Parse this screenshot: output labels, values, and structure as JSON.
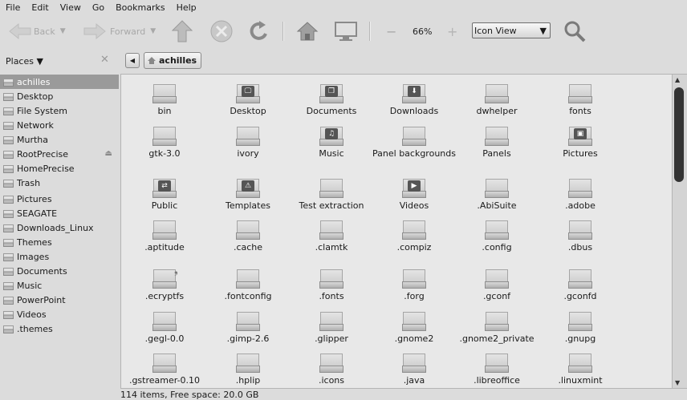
{
  "menu": [
    "File",
    "Edit",
    "View",
    "Go",
    "Bookmarks",
    "Help"
  ],
  "toolbar": {
    "back_label": "Back",
    "forward_label": "Forward",
    "zoom_level": "66%",
    "view_mode": "Icon View"
  },
  "places": {
    "label": "Places ▼"
  },
  "path": {
    "current": "achilles"
  },
  "sidebar": {
    "items": [
      {
        "label": "achilles",
        "icon": "home-icon"
      },
      {
        "label": "Desktop",
        "icon": "folder-icon"
      },
      {
        "label": "File System",
        "icon": "harddisk-icon"
      },
      {
        "label": "Network",
        "icon": "network-icon"
      },
      {
        "label": "Murtha",
        "icon": "folder-icon"
      },
      {
        "label": "RootPrecise",
        "icon": "drive-icon"
      },
      {
        "label": "HomePrecise",
        "icon": "drive-icon"
      },
      {
        "label": "Trash",
        "icon": "trash-icon"
      },
      {
        "label": "Pictures",
        "icon": "folder-icon"
      },
      {
        "label": "SEAGATE",
        "icon": "folder-icon"
      },
      {
        "label": "Downloads_Linux",
        "icon": "folder-icon"
      },
      {
        "label": "Themes",
        "icon": "folder-icon"
      },
      {
        "label": "Images",
        "icon": "folder-icon"
      },
      {
        "label": "Documents",
        "icon": "folder-icon"
      },
      {
        "label": "Music",
        "icon": "folder-icon"
      },
      {
        "label": "PowerPoint",
        "icon": "folder-icon"
      },
      {
        "label": "Videos",
        "icon": "folder-icon"
      },
      {
        "label": ".themes",
        "icon": "folder-icon"
      }
    ]
  },
  "files": [
    {
      "name": "bin",
      "icon": "folder-icon"
    },
    {
      "name": "Desktop",
      "icon": "desktop-icon"
    },
    {
      "name": "Documents",
      "icon": "documents-folder-icon"
    },
    {
      "name": "Downloads",
      "icon": "downloads-folder-icon"
    },
    {
      "name": "dwhelper",
      "icon": "folder-icon"
    },
    {
      "name": "fonts",
      "icon": "folder-icon"
    },
    {
      "name": "gtk-3.0",
      "icon": "folder-icon"
    },
    {
      "name": "ivory",
      "icon": "folder-icon"
    },
    {
      "name": "Music",
      "icon": "music-folder-icon"
    },
    {
      "name": "Panel backgrounds",
      "icon": "folder-icon"
    },
    {
      "name": "Panels",
      "icon": "folder-icon"
    },
    {
      "name": "Pictures",
      "icon": "pictures-folder-icon"
    },
    {
      "name": "Public",
      "icon": "public-folder-icon"
    },
    {
      "name": "Templates",
      "icon": "templates-folder-icon"
    },
    {
      "name": "Test extraction",
      "icon": "folder-icon"
    },
    {
      "name": "Videos",
      "icon": "videos-folder-icon"
    },
    {
      "name": ".AbiSuite",
      "icon": "folder-icon"
    },
    {
      "name": ".adobe",
      "icon": "folder-icon"
    },
    {
      "name": ".aptitude",
      "icon": "folder-icon"
    },
    {
      "name": ".cache",
      "icon": "folder-icon"
    },
    {
      "name": ".clamtk",
      "icon": "folder-icon"
    },
    {
      "name": ".compiz",
      "icon": "folder-icon"
    },
    {
      "name": ".config",
      "icon": "folder-icon"
    },
    {
      "name": ".dbus",
      "icon": "folder-icon"
    },
    {
      "name": ".ecryptfs",
      "icon": "link-folder-icon"
    },
    {
      "name": ".fontconfig",
      "icon": "folder-icon"
    },
    {
      "name": ".fonts",
      "icon": "folder-icon"
    },
    {
      "name": ".forg",
      "icon": "folder-icon"
    },
    {
      "name": ".gconf",
      "icon": "folder-icon"
    },
    {
      "name": ".gconfd",
      "icon": "folder-icon"
    },
    {
      "name": ".gegl-0.0",
      "icon": "folder-icon"
    },
    {
      "name": ".gimp-2.6",
      "icon": "folder-icon"
    },
    {
      "name": ".glipper",
      "icon": "folder-icon"
    },
    {
      "name": ".gnome2",
      "icon": "folder-icon"
    },
    {
      "name": ".gnome2_private",
      "icon": "folder-icon"
    },
    {
      "name": ".gnupg",
      "icon": "folder-icon"
    },
    {
      "name": ".gstreamer-0.10",
      "icon": "folder-icon"
    },
    {
      "name": ".hplip",
      "icon": "folder-icon"
    },
    {
      "name": ".icons",
      "icon": "folder-icon"
    },
    {
      "name": ".java",
      "icon": "folder-icon"
    },
    {
      "name": ".libreoffice",
      "icon": "folder-icon"
    },
    {
      "name": ".linuxmint",
      "icon": "folder-icon"
    }
  ],
  "status": {
    "text": "114 items, Free space: 20.0 GB"
  }
}
